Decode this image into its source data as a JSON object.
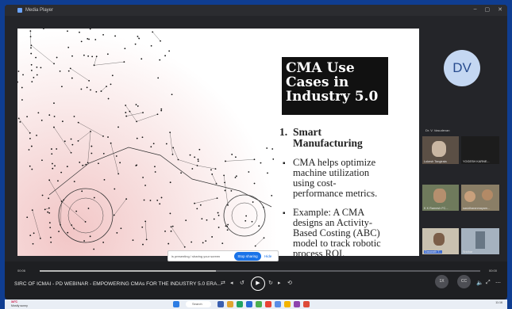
{
  "window": {
    "title": "Media Player"
  },
  "slide": {
    "title_lines": [
      "CMA Use",
      "Cases in",
      "Industry 5.0"
    ],
    "section_number": "1.",
    "section_title_lines": [
      "Smart",
      "Manufacturing"
    ],
    "bullet1_lines": [
      "CMA helps optimize",
      "machine utilization",
      "using cost-",
      "performance metrics."
    ],
    "bullet2_lines": [
      "Example: A CMA",
      "designs an Activity-",
      "Based Costing (ABC)",
      "model to track robotic",
      "process ROI."
    ],
    "bullet_symbol": "▪"
  },
  "share_bar": {
    "text": "is presenting / sharing your screen",
    "stop_label": "Stop sharing",
    "hide_label": "Hide"
  },
  "participants": {
    "host_initials": "DV",
    "host_name": "Dr. V. Vasudevan",
    "tiles": [
      {
        "name": "Lokesh Tangirala"
      },
      {
        "name": "YOGESH KARNE..."
      },
      {
        "name": "K K Ramesh FC..."
      },
      {
        "name": "sasidharanmayam..."
      },
      {
        "name": "Dasarath T..."
      },
      {
        "name": "Sridhar"
      }
    ]
  },
  "player": {
    "elapsed": "00:06",
    "total": "00:00",
    "progress": 0.4,
    "video_title": "SIRC OF ICMAI - PD WEBINAR - EMPOWERING CMAs FOR THE INDUSTRY 5.0 ERA...",
    "speed_label": "1X"
  },
  "taskbar": {
    "temp": "34°C",
    "weather": "Mostly sunny",
    "search": "Search",
    "tray_lang": "ENG\nIN",
    "time": "11:16"
  },
  "colors": {
    "desktop": "#0f3d91",
    "accent": "#1a73e8",
    "slide_title_bg": "#111111"
  }
}
